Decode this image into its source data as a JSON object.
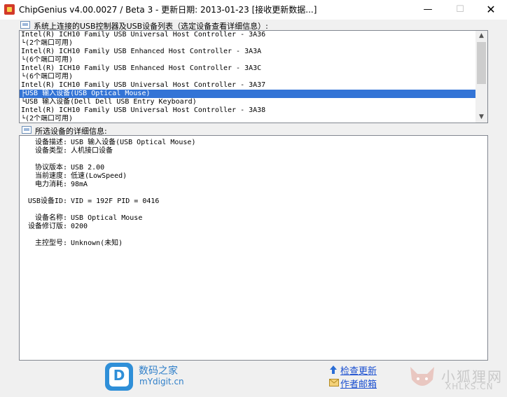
{
  "window": {
    "title": "ChipGenius v4.00.0027 / Beta 3 - 更新日期: 2013-01-23 [接收更新数据...]",
    "min_glyph": "—",
    "max_glyph": "☐",
    "close_glyph": "✕"
  },
  "device_list": {
    "label": "系统上连接的USB控制器及USB设备列表（选定设备查看详细信息）:",
    "items": [
      "Intel(R) ICH10 Family USB Universal Host Controller - 3A36",
      "└(2个端口可用)",
      "Intel(R) ICH10 Family USB Enhanced Host Controller - 3A3A",
      "└(6个端口可用)",
      "Intel(R) ICH10 Family USB Enhanced Host Controller - 3A3C",
      "└(6个端口可用)",
      "Intel(R) ICH10 Family USB Universal Host Controller - 3A37",
      "├USB 输入设备(USB Optical Mouse)",
      "└USB 输入设备(Dell Dell USB Entry Keyboard)",
      "Intel(R) ICH10 Family USB Universal Host Controller - 3A38",
      "└(2个端口可用)"
    ],
    "selected_index": 7,
    "scroll_up": "▲",
    "scroll_down": "▼"
  },
  "details": {
    "label": "所选设备的详细信息:",
    "rows": [
      {
        "label": "设备描述:",
        "value": "USB 输入设备(USB Optical Mouse)"
      },
      {
        "label": "设备类型:",
        "value": "人机接口设备"
      },
      {
        "label": "协议版本:",
        "value": "USB 2.00"
      },
      {
        "label": "当前速度:",
        "value": "低速(LowSpeed)"
      },
      {
        "label": "电力消耗:",
        "value": "98mA"
      },
      {
        "label": "USB设备ID:",
        "value": "VID = 192F PID = 0416"
      },
      {
        "label": "设备名称:",
        "value": "USB Optical Mouse"
      },
      {
        "label": "设备修订版:",
        "value": "0200"
      },
      {
        "label": "主控型号:",
        "value": "Unknown(未知)"
      }
    ]
  },
  "footer": {
    "logo_letter": "D",
    "site_name": "数码之家",
    "site_url": "mYdigit.cn",
    "check_update": "检查更新",
    "author_email": "作者邮箱",
    "check_update_icon": "up-arrow-icon",
    "author_email_icon": "envelope-icon"
  },
  "watermark": {
    "cn": "小狐狸网",
    "en": "XHLKS.CN"
  }
}
